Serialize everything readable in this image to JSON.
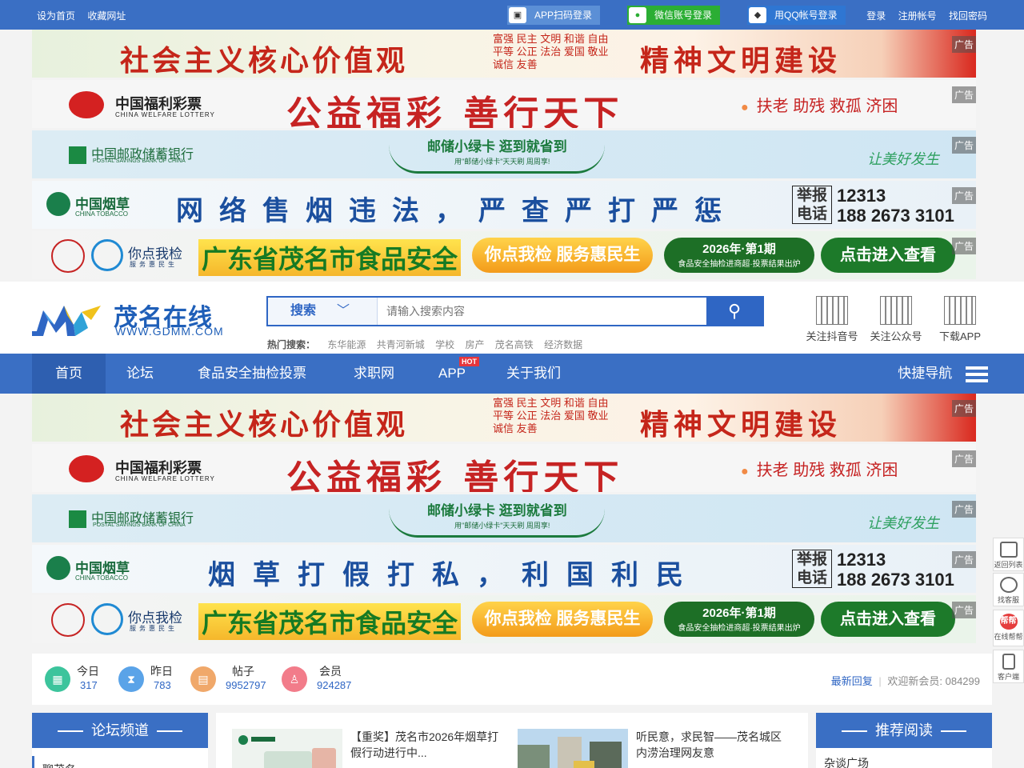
{
  "topbar": {
    "set_home": "设为首页",
    "bookmark": "收藏网址",
    "app_login": "APP扫码登录",
    "wechat_login": "微信账号登录",
    "qq_login": "用QQ帐号登录",
    "login": "登录",
    "register": "注册帐号",
    "recover": "找回密码"
  },
  "ad_tag": "广告",
  "ads": {
    "values": {
      "slogan": "社会主义核心价值观",
      "values_text": "富强 民主 文明 和谐 自由 平等 公正 法治 爱国 敬业 诚信 友善",
      "slogan2": "精神文明建设"
    },
    "lottery": {
      "name": "中国福利彩票",
      "en": "CHINA WELFARE LOTTERY",
      "slogan": "公益福彩 善行天下",
      "right": "扶老 助残 救孤 济困"
    },
    "postal": {
      "name": "中国邮政储蓄银行",
      "en": "POSTAL SAVINGS BANK OF CHINA",
      "slogan": "邮储小绿卡 逛到就省到",
      "sub": "用\"邮储小绿卡\"天天刷 周周享!",
      "right": "让美好发生"
    },
    "tobacco1": {
      "name": "中国烟草",
      "en": "CHINA TOBACCO",
      "slogan": "网络售烟违法，严查严打严惩",
      "report": "举报电话",
      "tel": "12313\n188 2673 3101"
    },
    "food": {
      "brand": "你点我检",
      "brand_sub": "服务惠民生",
      "big": "广东省茂名市食品安全",
      "mid": "你点我检 服务惠民生",
      "qi_a": "2026年·第1期",
      "qi_b": "食品安全抽检进商超·投票结果出炉",
      "go": "点击进入查看"
    },
    "tobacco2": {
      "slogan": "烟草打假打私，利国利民"
    }
  },
  "header": {
    "logo_text": "茂名在线",
    "logo_url": "WWW.GDMM.COM",
    "search_cat": "搜索",
    "search_placeholder": "请输入搜索内容",
    "hot_label": "热门搜索：",
    "hot": [
      "东华能源",
      "共青河新城",
      "学校",
      "房产",
      "茂名高铁",
      "经济数据"
    ],
    "qr": [
      "关注抖音号",
      "关注公众号",
      "下载APP"
    ]
  },
  "nav": {
    "items": [
      "首页",
      "论坛",
      "食品安全抽检投票",
      "求职网",
      "APP",
      "关于我们"
    ],
    "hot_badge": "HOT",
    "quick": "快捷导航"
  },
  "stats": {
    "today_label": "今日",
    "today": "317",
    "yesterday_label": "昨日",
    "yesterday": "783",
    "posts_label": "帖子",
    "posts": "9952797",
    "members_label": "会员",
    "members": "924287",
    "latest": "最新回复",
    "welcome": "欢迎新会员: 084299"
  },
  "left": {
    "title": "论坛频道",
    "item": "聊茂名"
  },
  "news": [
    "【重奖】茂名市2026年烟草打假行动进行中...",
    "听民意，求民智——茂名城区内涝治理网友意"
  ],
  "right": {
    "title": "推荐阅读",
    "item": "杂谈广场"
  },
  "side": [
    "返回列表",
    "找客服",
    "在线帮帮",
    "客户端"
  ],
  "side_badge": "帮帮"
}
